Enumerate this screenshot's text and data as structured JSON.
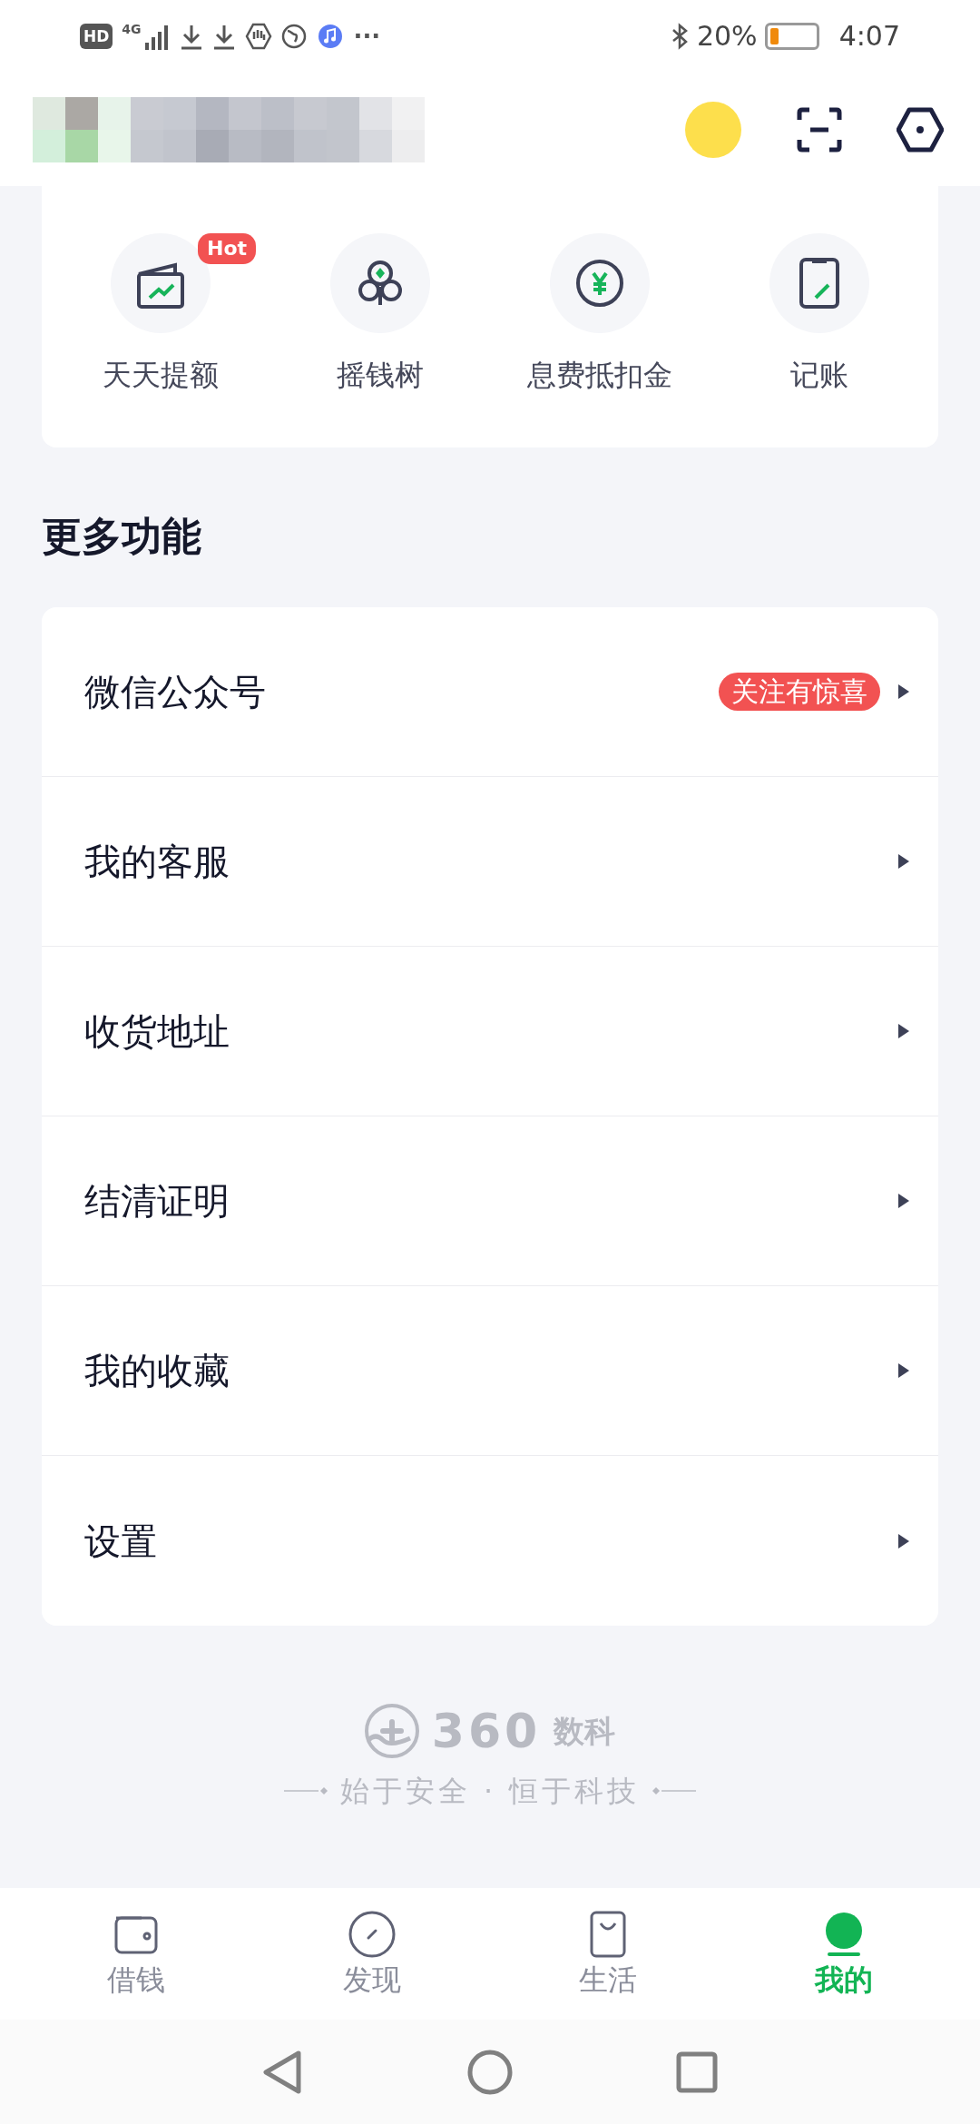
{
  "status_bar": {
    "hd": "HD",
    "network": "4G",
    "more": "···",
    "battery": "20%",
    "time": "4:07"
  },
  "quick_actions": [
    {
      "label": "天天提额",
      "badge": "Hot"
    },
    {
      "label": "摇钱树"
    },
    {
      "label": "息费抵扣金"
    },
    {
      "label": "记账"
    }
  ],
  "section_title": "更多功能",
  "menu": [
    {
      "label": "微信公众号",
      "badge": "关注有惊喜"
    },
    {
      "label": "我的客服"
    },
    {
      "label": "收货地址"
    },
    {
      "label": "结清证明"
    },
    {
      "label": "我的收藏"
    },
    {
      "label": "设置"
    }
  ],
  "footer": {
    "brand_number": "360",
    "brand_name": "数科",
    "slogan": "始于安全 · 恒于科技"
  },
  "tabs": [
    {
      "label": "借钱",
      "selected": false
    },
    {
      "label": "发现",
      "selected": false
    },
    {
      "label": "生活",
      "selected": false
    },
    {
      "label": "我的",
      "selected": true
    }
  ]
}
